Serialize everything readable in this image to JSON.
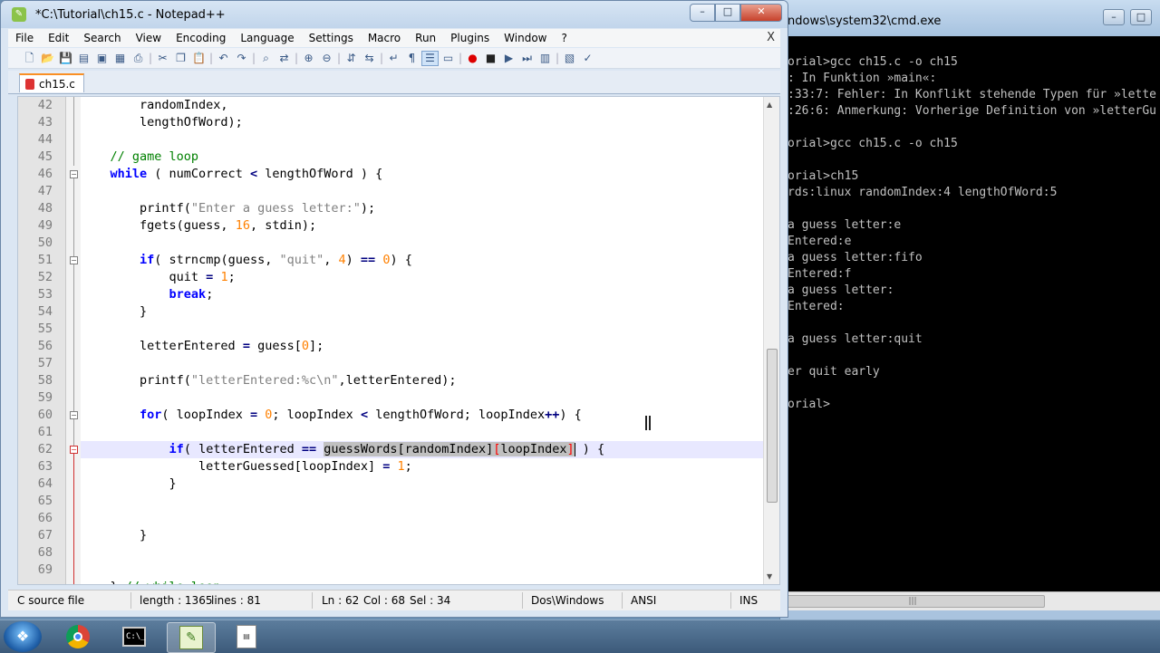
{
  "cmd": {
    "title": "ndows\\system32\\cmd.exe",
    "controls": [
      "–",
      "□"
    ],
    "lines": [
      "orial>gcc ch15.c -o ch15",
      ": In Funktion »main«:",
      ":33:7: Fehler: In Konflikt stehende Typen für »lette",
      ":26:6: Anmerkung: Vorherige Definition von »letterGu",
      "",
      "orial>gcc ch15.c -o ch15",
      "",
      "orial>ch15",
      "rds:linux randomIndex:4 lengthOfWord:5",
      "",
      "a guess letter:e",
      "Entered:e",
      "a guess letter:fifo",
      "Entered:f",
      "a guess letter:",
      "Entered:",
      "",
      "a guess letter:quit",
      "",
      "er quit early",
      "",
      "orial>"
    ]
  },
  "notepad": {
    "title": "*C:\\Tutorial\\ch15.c - Notepad++",
    "controls": {
      "min": "–",
      "max": "□",
      "close": "✕"
    },
    "menu": [
      "File",
      "Edit",
      "Search",
      "View",
      "Encoding",
      "Language",
      "Settings",
      "Macro",
      "Run",
      "Plugins",
      "Window",
      "?"
    ],
    "menu_close": "X",
    "tab": {
      "label": "ch15.c"
    },
    "line_numbers": [
      "42",
      "43",
      "44",
      "45",
      "46",
      "47",
      "48",
      "49",
      "50",
      "51",
      "52",
      "53",
      "54",
      "55",
      "56",
      "57",
      "58",
      "59",
      "60",
      "61",
      "62",
      "63",
      "64",
      "65",
      "66",
      "67",
      "68",
      "69"
    ],
    "status": {
      "file_type": "C source file",
      "length": "length : 1365",
      "lines": "lines : 81",
      "ln": "Ln : 62",
      "col": "Col : 68",
      "sel": "Sel : 34",
      "eol": "Dos\\Windows",
      "encoding": "ANSI",
      "mode": "INS"
    }
  },
  "taskbar": {
    "apps": [
      "chrome-icon",
      "cmd-icon",
      "notepadpp-icon",
      "document-icon"
    ]
  },
  "colors": {
    "keyword": "#0000ff",
    "comment": "#008000",
    "string": "#808080",
    "number": "#ff8000",
    "current_line": "#e8e8ff",
    "selection": "#c0c0c0"
  }
}
